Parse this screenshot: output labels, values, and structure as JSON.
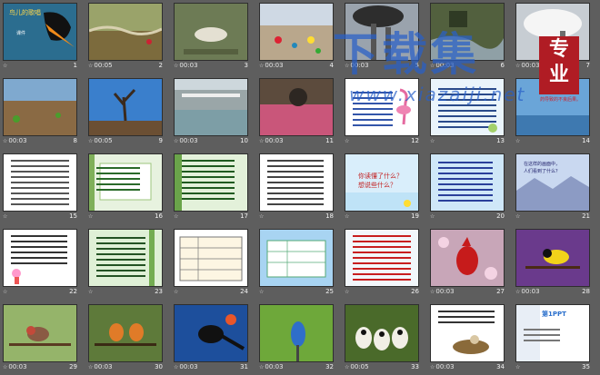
{
  "app": {
    "view": "slide-sorter"
  },
  "thumbs": [
    {
      "num": "1",
      "time": "",
      "art": "title",
      "text": "鸟儿的歌唱",
      "text2": "课件"
    },
    {
      "num": "2",
      "time": "00:05",
      "art": "field"
    },
    {
      "num": "3",
      "time": "00:03",
      "art": "bird-dead"
    },
    {
      "num": "4",
      "time": "00:03",
      "art": "beach-trash"
    },
    {
      "num": "5",
      "time": "00:03",
      "art": "smokestack"
    },
    {
      "num": "6",
      "time": "00:03",
      "art": "river"
    },
    {
      "num": "7",
      "time": "00:03",
      "art": "smoke"
    },
    {
      "num": "8",
      "time": "00:03",
      "art": "dry-land"
    },
    {
      "num": "9",
      "time": "00:05",
      "art": "dead-tree"
    },
    {
      "num": "10",
      "time": "00:03",
      "art": "dam"
    },
    {
      "num": "11",
      "time": "00:03",
      "art": "pink-water"
    },
    {
      "num": "12",
      "time": "",
      "art": "flamingo-text"
    },
    {
      "num": "13",
      "time": "",
      "art": "blue-text"
    },
    {
      "num": "14",
      "time": "",
      "art": "sea-text",
      "text": "生活中使用农药导致的不良后果。"
    },
    {
      "num": "15",
      "time": "",
      "art": "doc"
    },
    {
      "num": "16",
      "time": "",
      "art": "bamboo-text"
    },
    {
      "num": "17",
      "time": "",
      "art": "bamboo-text2"
    },
    {
      "num": "18",
      "time": "",
      "art": "doc2"
    },
    {
      "num": "19",
      "time": "",
      "art": "question",
      "text": "你读懂了什么？",
      "text2": "想说些什么？"
    },
    {
      "num": "20",
      "time": "",
      "art": "sky-text"
    },
    {
      "num": "21",
      "time": "",
      "art": "mountain-text",
      "text": "在这样的画面中，人们看到了什么？"
    },
    {
      "num": "22",
      "time": "",
      "art": "girl-text"
    },
    {
      "num": "23",
      "time": "",
      "art": "bamboo-text3"
    },
    {
      "num": "24",
      "time": "",
      "art": "table"
    },
    {
      "num": "25",
      "time": "",
      "art": "sky-table"
    },
    {
      "num": "26",
      "time": "",
      "art": "red-text"
    },
    {
      "num": "27",
      "time": "00:03",
      "art": "cardinal"
    },
    {
      "num": "28",
      "time": "00:03",
      "art": "goldfinch"
    },
    {
      "num": "29",
      "time": "00:03",
      "art": "finch"
    },
    {
      "num": "30",
      "time": "00:03",
      "art": "two-birds"
    },
    {
      "num": "31",
      "time": "00:03",
      "art": "magpie"
    },
    {
      "num": "32",
      "time": "00:03",
      "art": "bluebird"
    },
    {
      "num": "33",
      "time": "00:05",
      "art": "owls"
    },
    {
      "num": "34",
      "time": "00:03",
      "art": "nest-text"
    },
    {
      "num": "35",
      "time": "",
      "art": "ppt-end",
      "text": "第1PPT"
    }
  ],
  "watermark": {
    "text": "下载集",
    "url": "www.xiazaiji.net",
    "seal1": "专",
    "seal2": "业"
  },
  "colors": {
    "background": "#5e5e5e",
    "watermark": "#285fc8",
    "seal": "#b01c24"
  }
}
